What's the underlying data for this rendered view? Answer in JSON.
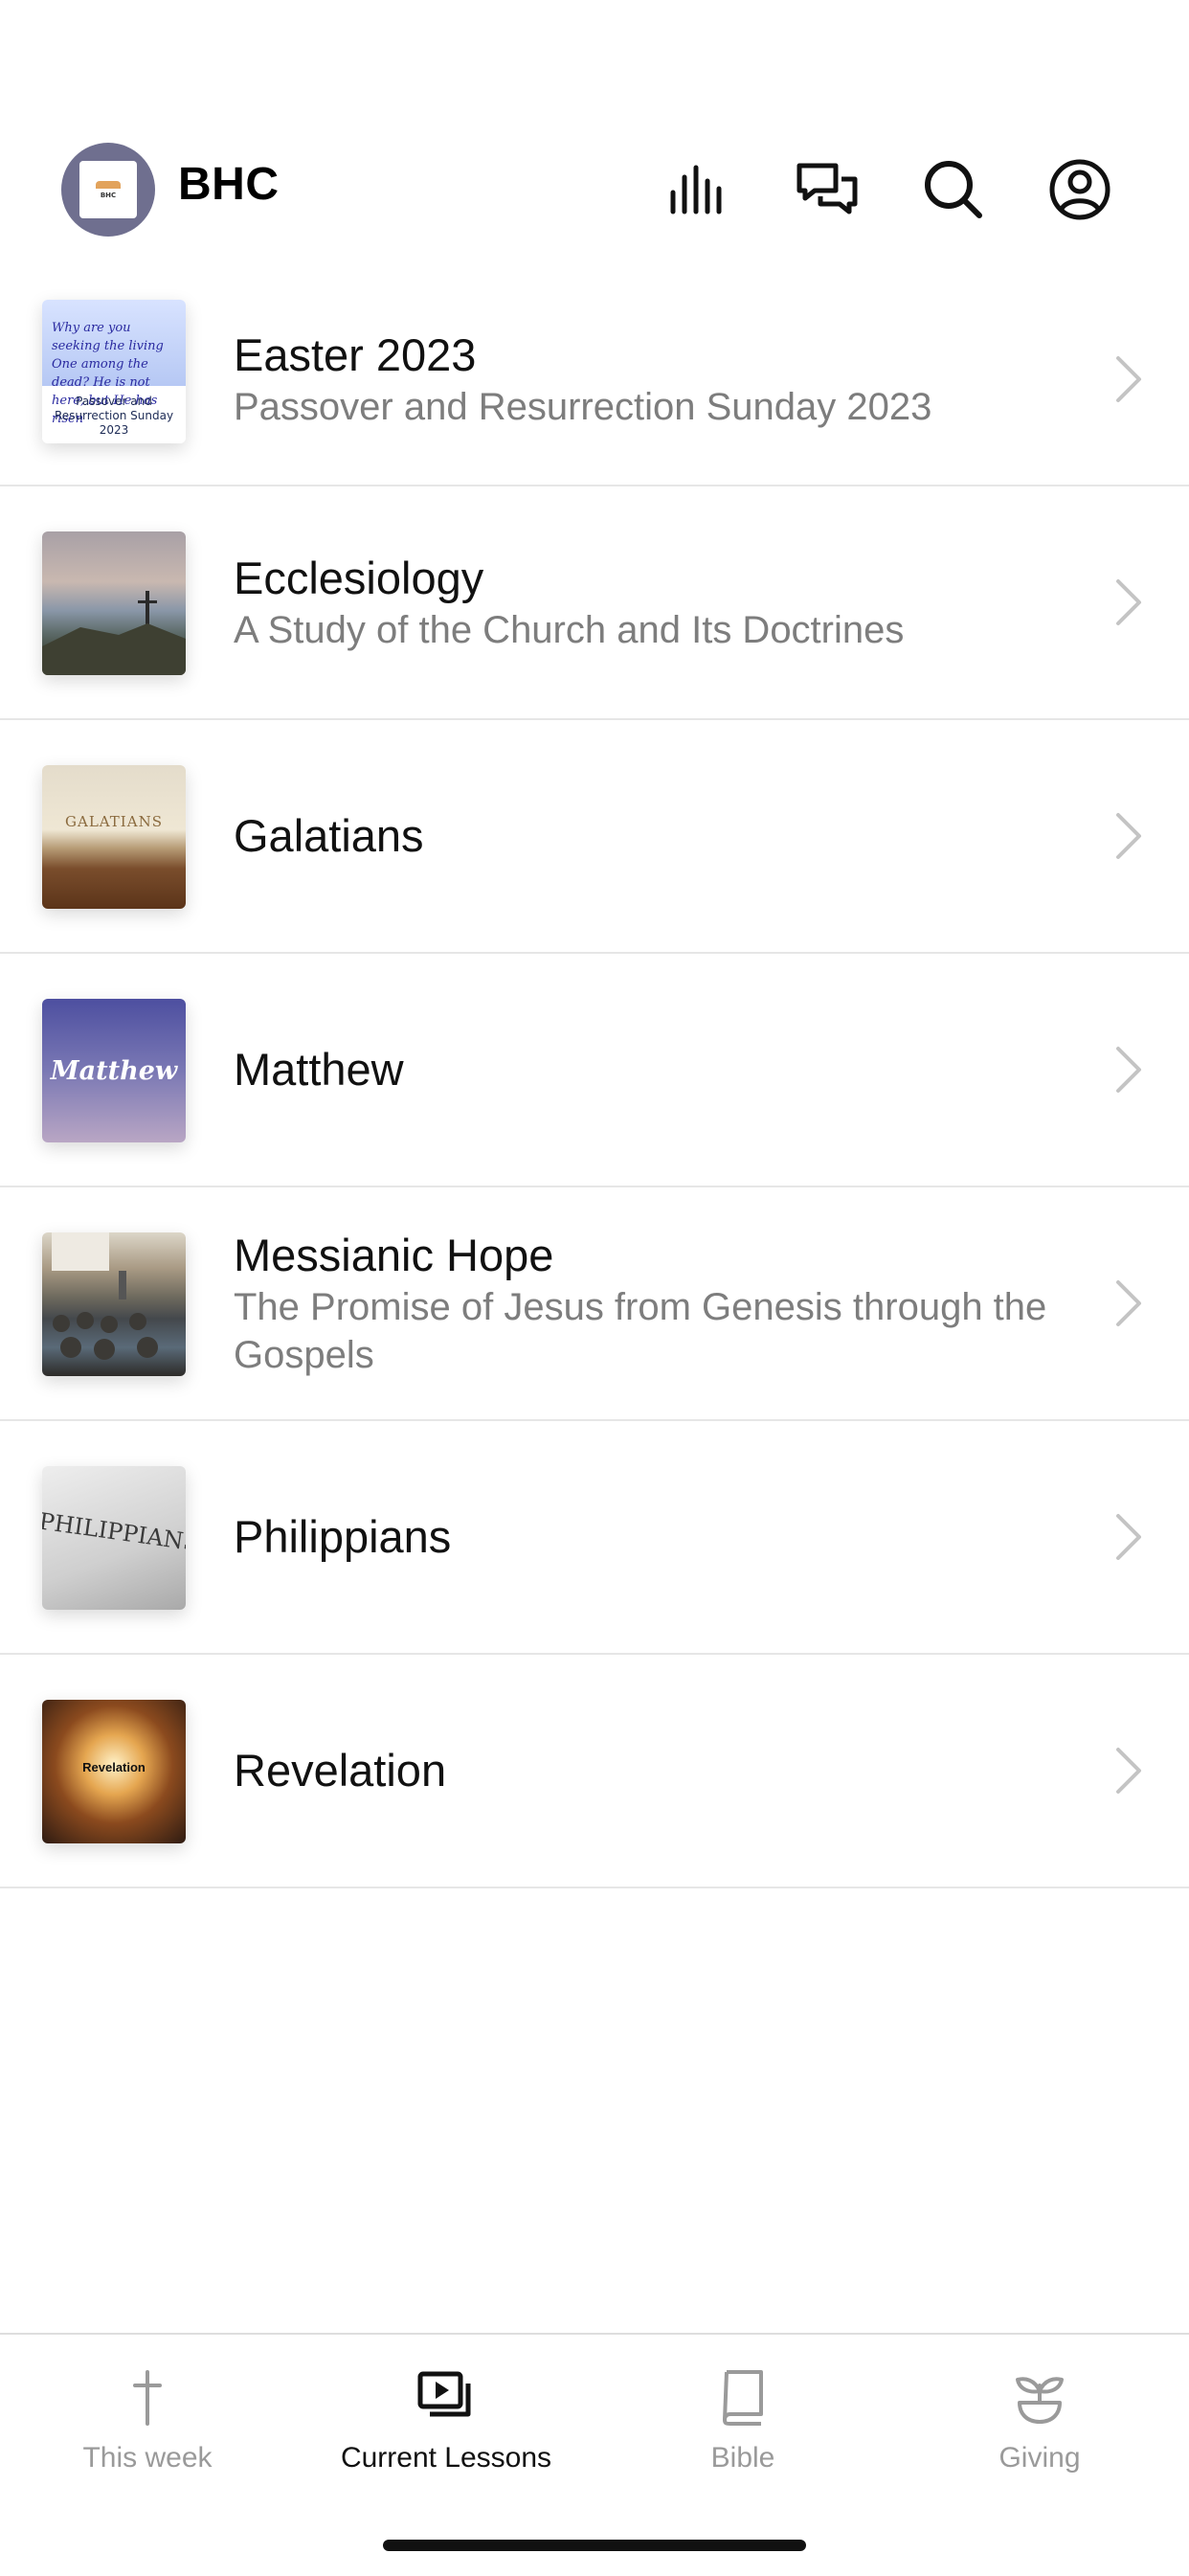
{
  "header": {
    "title": "BHC",
    "avatar_text": "BHC"
  },
  "lessons": [
    {
      "title": "Easter 2023",
      "subtitle": "Passover and Resurrection Sunday 2023",
      "thumb_verse": "Why are you seeking the living One among the dead? He is not here, but He has risen",
      "thumb_caption": "Passover and Resurrection Sunday 2023"
    },
    {
      "title": "Ecclesiology",
      "subtitle": "A Study of the Church and Its Doctrines"
    },
    {
      "title": "Galatians",
      "subtitle": "",
      "thumb_text": "GALATIANS"
    },
    {
      "title": "Matthew",
      "subtitle": "",
      "thumb_text": "Matthew"
    },
    {
      "title": "Messianic Hope",
      "subtitle": "The Promise of Jesus from Genesis through the Gospels"
    },
    {
      "title": "Philippians",
      "subtitle": "",
      "thumb_text": "PHILIPPIANS"
    },
    {
      "title": "Revelation",
      "subtitle": "",
      "thumb_text": "Revelation"
    }
  ],
  "tabs": [
    {
      "label": "This week",
      "icon": "cross-icon",
      "active": false
    },
    {
      "label": "Current Lessons",
      "icon": "video-library-icon",
      "active": true
    },
    {
      "label": "Bible",
      "icon": "book-icon",
      "active": false
    },
    {
      "label": "Giving",
      "icon": "plant-icon",
      "active": false
    }
  ],
  "colors": {
    "active_tab": "#111111",
    "inactive_tab": "#9a9a9a",
    "subtitle": "#7d7d7d",
    "avatar_bg": "#6f6f8f"
  }
}
